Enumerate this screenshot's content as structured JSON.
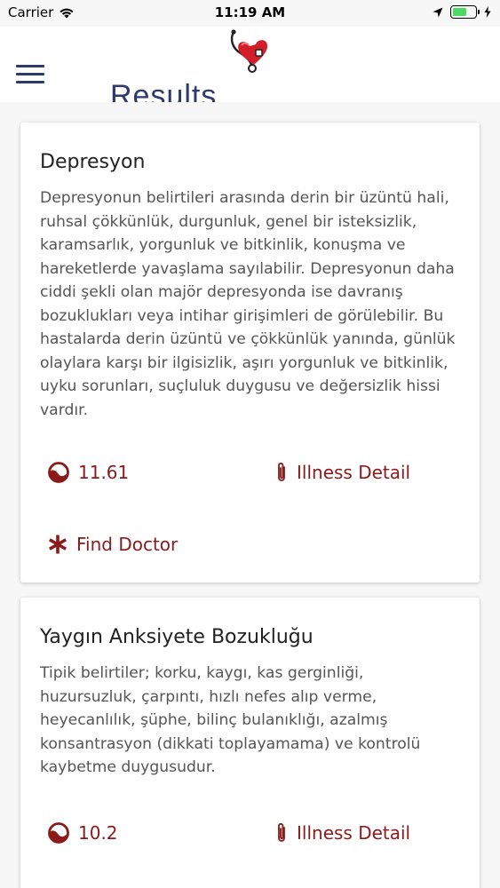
{
  "status_bar": {
    "carrier": "Carrier",
    "time": "11:19 AM"
  },
  "header": {
    "title": "Results"
  },
  "colors": {
    "accent": "#8b1a1a",
    "title_navy": "#2d3a6e",
    "battery_green": "#4cd964"
  },
  "results": [
    {
      "title": "Depresyon",
      "description": "Depresyonun belirtileri arasında derin bir üzüntü hali, ruhsal çökkünlük, durgunluk, genel bir isteksizlik, karamsarlık, yorgunluk ve bitkinlik, konuşma ve hareketlerde yavaşlama sayılabilir. Depresyonun daha ciddi şekli olan majör depresyonda ise davranış bozuklukları veya intihar girişimleri de görülebilir. Bu hastalarda derin üzüntü ve çökkünlük yanında, günlük olaylara karşı bir ilgisizlik, aşırı yorgunluk ve bitkinlik, uyku sorunları, suçluluk duygusu ve değersizlik hissi vardır.",
      "score": "11.61",
      "detail_label": "Illness Detail",
      "doctor_label": "Find Doctor"
    },
    {
      "title": "Yaygın Anksiyete Bozukluğu",
      "description": "Tipik belirtiler; korku, kaygı, kas gerginliği, huzursuzluk, çarpıntı, hızlı nefes alıp verme, heyecanlılık, şüphe, bilinç bulanıklığı, azalmış konsantrasyon (dikkati toplayamama) ve kontrolü kaybetme duygusudur.",
      "score": "10.2",
      "detail_label": "Illness Detail"
    }
  ]
}
